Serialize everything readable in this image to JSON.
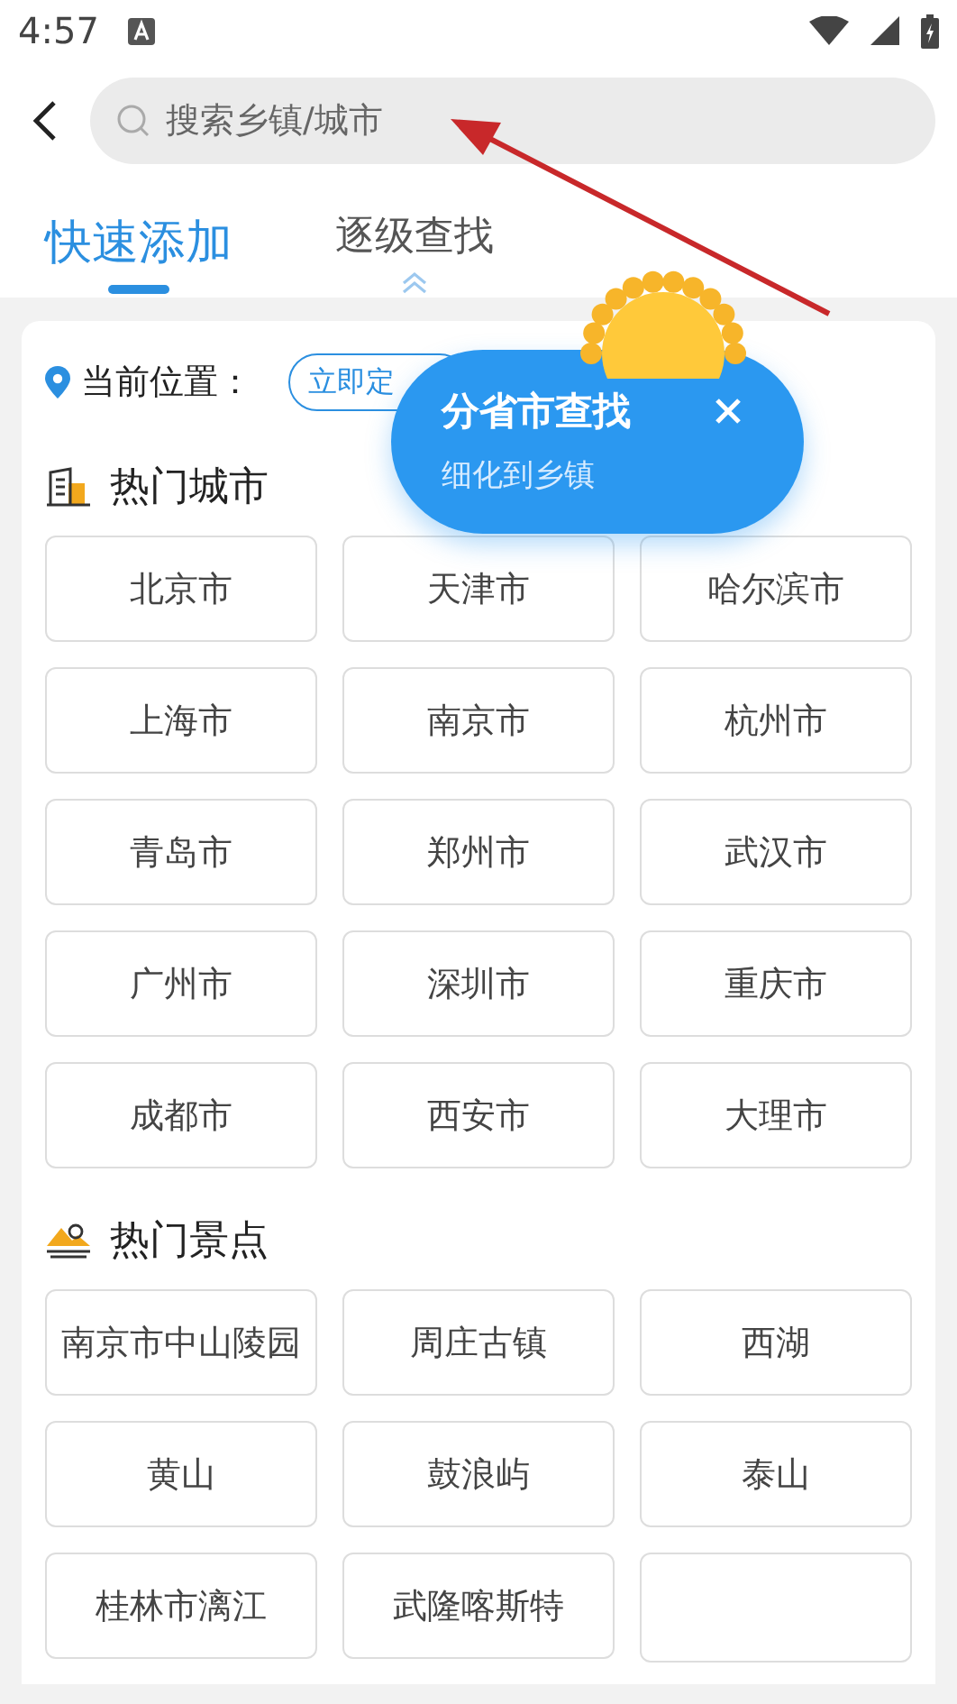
{
  "status_bar": {
    "time": "4:57"
  },
  "search": {
    "placeholder": "搜索乡镇/城市"
  },
  "tabs": [
    {
      "label": "快速添加",
      "selected": true
    },
    {
      "label": "逐级查找",
      "selected": false
    }
  ],
  "location": {
    "label": "当前位置：",
    "button": "立即定"
  },
  "sections": [
    {
      "kind": "city",
      "title": "热门城市",
      "items": [
        "北京市",
        "天津市",
        "哈尔滨市",
        "上海市",
        "南京市",
        "杭州市",
        "青岛市",
        "郑州市",
        "武汉市",
        "广州市",
        "深圳市",
        "重庆市",
        "成都市",
        "西安市",
        "大理市"
      ]
    },
    {
      "kind": "scenic",
      "title": "热门景点",
      "items": [
        "南京市中山陵园",
        "周庄古镇",
        "西湖",
        "黄山",
        "鼓浪屿",
        "泰山",
        "桂林市漓江",
        "武隆喀斯特"
      ]
    }
  ],
  "popup": {
    "title": "分省市查找",
    "subtitle": "细化到乡镇"
  }
}
